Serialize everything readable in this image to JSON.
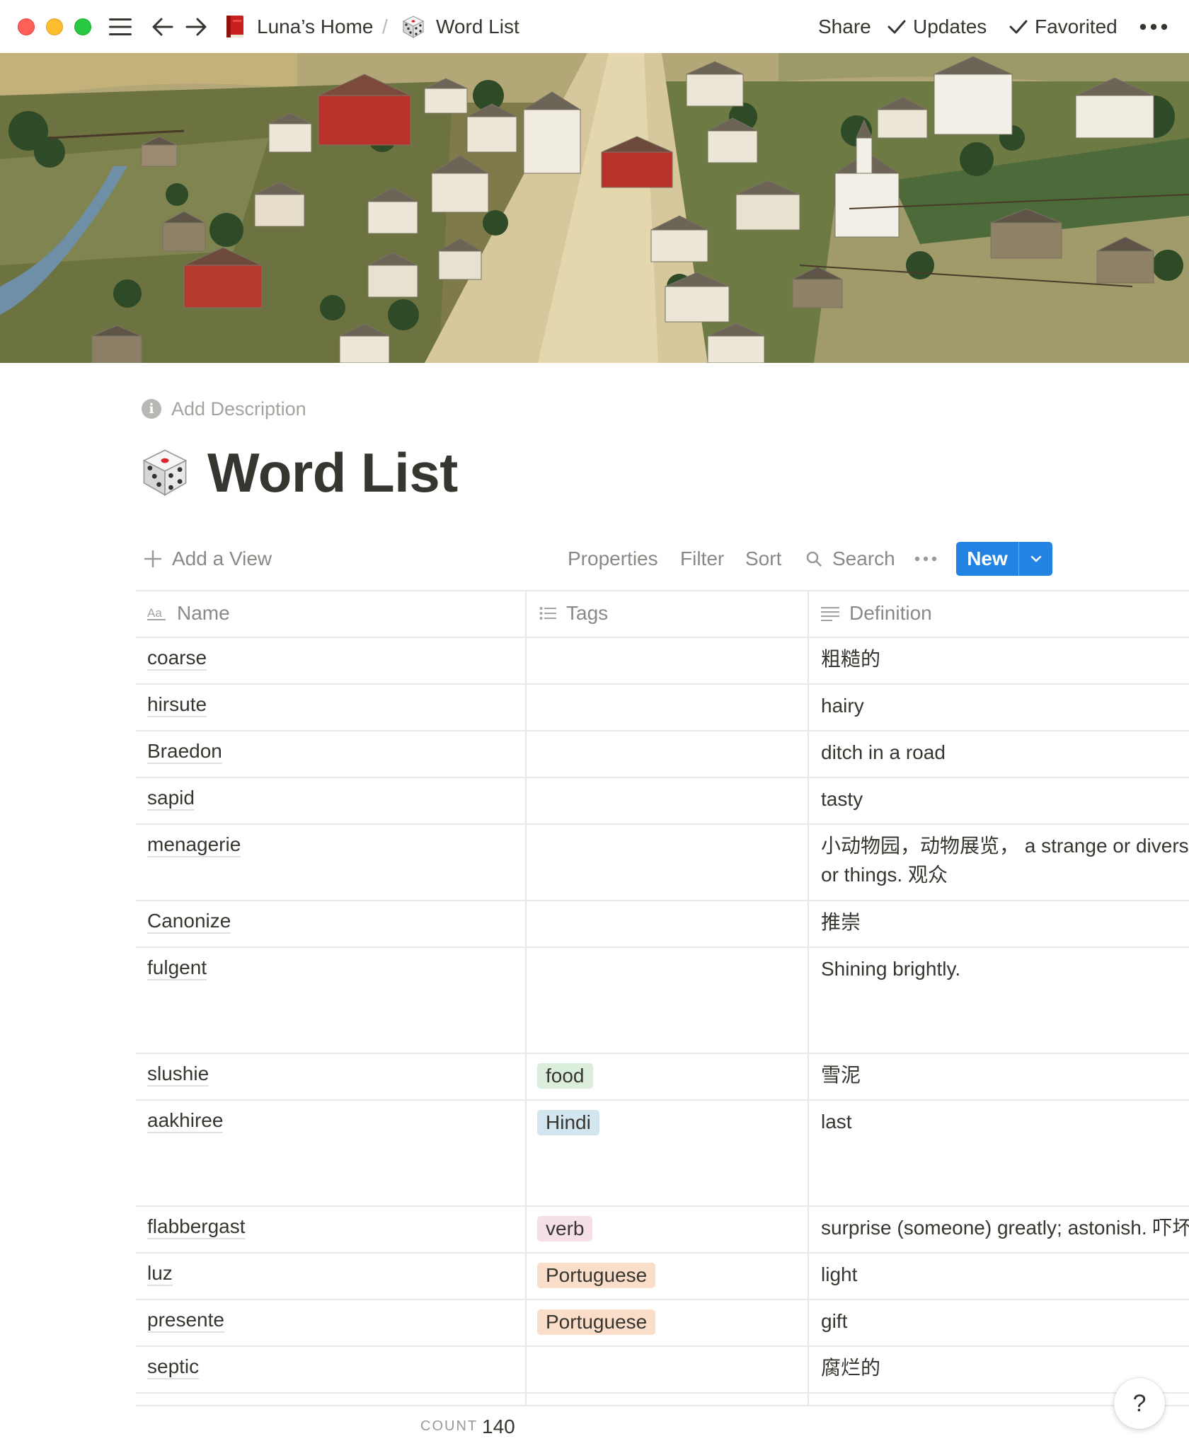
{
  "topbar": {
    "breadcrumbs": [
      {
        "icon": "red-book-icon",
        "label": "Luna’s Home"
      },
      {
        "icon": "game-die-icon",
        "label": "Word List"
      }
    ],
    "separator": "/",
    "share_label": "Share",
    "updates_label": "Updates",
    "favorited_label": "Favorited"
  },
  "page": {
    "add_description": "Add Description",
    "icon": "game-die-icon",
    "title": "Word List"
  },
  "toolbar": {
    "add_view": "Add a View",
    "properties": "Properties",
    "filter": "Filter",
    "sort": "Sort",
    "search": "Search",
    "new": "New"
  },
  "table": {
    "columns": [
      {
        "icon": "text-type-icon",
        "label": "Name"
      },
      {
        "icon": "list-icon",
        "label": "Tags"
      },
      {
        "icon": "lines-icon",
        "label": "Definition"
      }
    ],
    "rows": [
      {
        "name": "coarse",
        "tag": "",
        "definition": "粗糙的"
      },
      {
        "name": "hirsute",
        "tag": "",
        "definition": "hairy"
      },
      {
        "name": "Braedon",
        "tag": "",
        "definition": "ditch in a road"
      },
      {
        "name": "sapid",
        "tag": "",
        "definition": "tasty"
      },
      {
        "name": "menagerie",
        "tag": "",
        "definition": "小动物园，动物展览， a strange or diverse",
        "definition_line2": "or things. 观众"
      },
      {
        "name": "Canonize",
        "tag": "",
        "definition": "推崇"
      },
      {
        "name": "fulgent",
        "tag": "",
        "definition": "Shining brightly."
      },
      {
        "name": "slushie",
        "tag": "food",
        "tag_color": "#dbeddb",
        "definition": "雪泥"
      },
      {
        "name": "aakhiree",
        "tag": "Hindi",
        "tag_color": "#d3e5ef",
        "definition": "last"
      },
      {
        "name": "flabbergast",
        "tag": "verb",
        "tag_color": "#f5e0e9",
        "definition": "surprise (someone) greatly; astonish. 吓坏"
      },
      {
        "name": "luz",
        "tag": "Portuguese",
        "tag_color": "#fadec9",
        "definition": "light"
      },
      {
        "name": "presente",
        "tag": "Portuguese",
        "tag_color": "#fadec9",
        "definition": "gift"
      },
      {
        "name": "septic",
        "tag": "",
        "definition": "腐烂的"
      }
    ],
    "count_label": "COUNT",
    "count_value": "140"
  },
  "help_label": "?"
}
